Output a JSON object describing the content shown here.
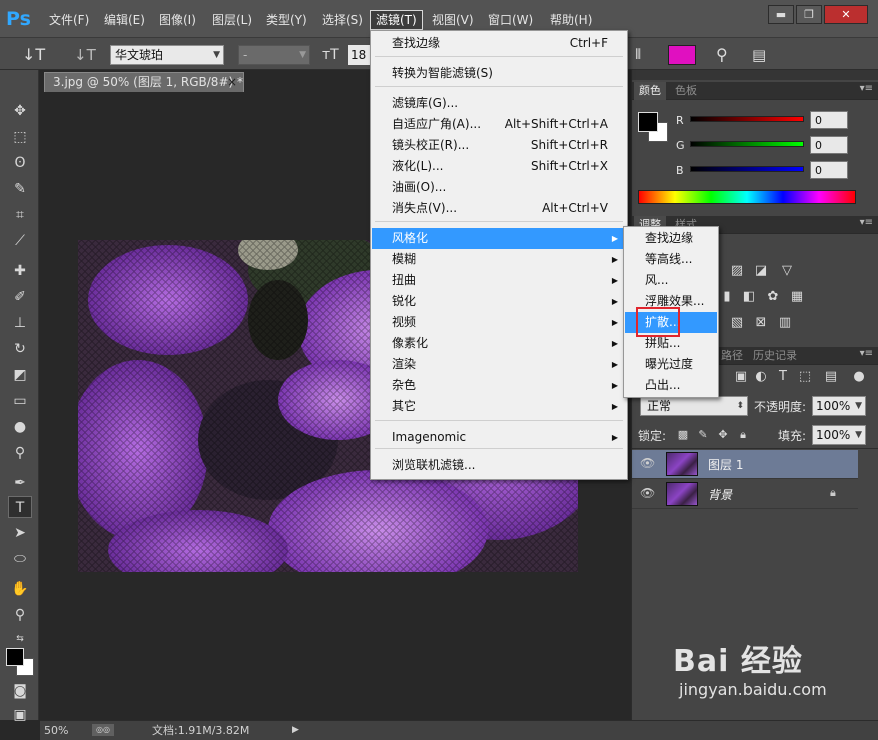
{
  "app": {
    "logo": "Ps"
  },
  "menubar": {
    "items": [
      "文件(F)",
      "编辑(E)",
      "图像(I)",
      "图层(L)",
      "类型(Y)",
      "选择(S)",
      "滤镜(T)",
      "视图(V)",
      "窗口(W)",
      "帮助(H)"
    ],
    "active_index": 6
  },
  "window_controls": {
    "minimize": "▬",
    "restore": "❐",
    "close": "✕"
  },
  "options_bar": {
    "tool_glyph": "↓T",
    "orient_glyph": "↓T",
    "font_family": "华文琥珀",
    "font_style": "-",
    "size_glyph": "тT",
    "font_size": "18",
    "text_color": "#e010c0"
  },
  "document_tab": {
    "title": "3.jpg @ 50% (图层 1, RGB/8#) *",
    "close": "×"
  },
  "filter_menu": {
    "items": [
      {
        "label": "查找边缘",
        "shortcut": "Ctrl+F"
      },
      {
        "label": "转换为智能滤镜(S)",
        "shortcut": ""
      },
      {
        "label": "滤镜库(G)...",
        "shortcut": ""
      },
      {
        "label": "自适应广角(A)...",
        "shortcut": "Alt+Shift+Ctrl+A"
      },
      {
        "label": "镜头校正(R)...",
        "shortcut": "Shift+Ctrl+R"
      },
      {
        "label": "液化(L)...",
        "shortcut": "Shift+Ctrl+X"
      },
      {
        "label": "油画(O)...",
        "shortcut": ""
      },
      {
        "label": "消失点(V)...",
        "shortcut": "Alt+Ctrl+V"
      },
      {
        "label": "风格化",
        "shortcut": ""
      },
      {
        "label": "模糊",
        "shortcut": ""
      },
      {
        "label": "扭曲",
        "shortcut": ""
      },
      {
        "label": "锐化",
        "shortcut": ""
      },
      {
        "label": "视频",
        "shortcut": ""
      },
      {
        "label": "像素化",
        "shortcut": ""
      },
      {
        "label": "渲染",
        "shortcut": ""
      },
      {
        "label": "杂色",
        "shortcut": ""
      },
      {
        "label": "其它",
        "shortcut": ""
      },
      {
        "label": "Imagenomic",
        "shortcut": ""
      },
      {
        "label": "浏览联机滤镜...",
        "shortcut": ""
      }
    ],
    "submenu_arrow": "▶"
  },
  "stylize_submenu": {
    "items": [
      "查找边缘",
      "等高线...",
      "风...",
      "浮雕效果...",
      "扩散...",
      "拼贴...",
      "曝光过度",
      "凸出..."
    ],
    "highlighted_index": 4
  },
  "color_panel": {
    "tabs": [
      "颜色",
      "色板"
    ],
    "channels": [
      {
        "label": "R",
        "value": "0"
      },
      {
        "label": "G",
        "value": "0"
      },
      {
        "label": "B",
        "value": "0"
      }
    ],
    "foreground": "#000000",
    "background": "#ffffff"
  },
  "adjustments_panel": {
    "tabs": [
      "调整",
      "样式"
    ]
  },
  "layers_panel": {
    "tabs": [
      "路径",
      "历史记录"
    ],
    "blend_mode": "正常",
    "opacity_label": "不透明度:",
    "opacity": "100%",
    "lock_label": "锁定:",
    "fill_label": "填充:",
    "fill": "100%",
    "layers": [
      {
        "name": "图层 1",
        "selected": true,
        "locked": false
      },
      {
        "name": "背景",
        "selected": false,
        "locked": true
      }
    ]
  },
  "status": {
    "zoom": "50%",
    "doc": "文档:1.91M/3.82M"
  },
  "watermark": {
    "brand": "Bai 经验",
    "url": "jingyan.baidu.com"
  }
}
